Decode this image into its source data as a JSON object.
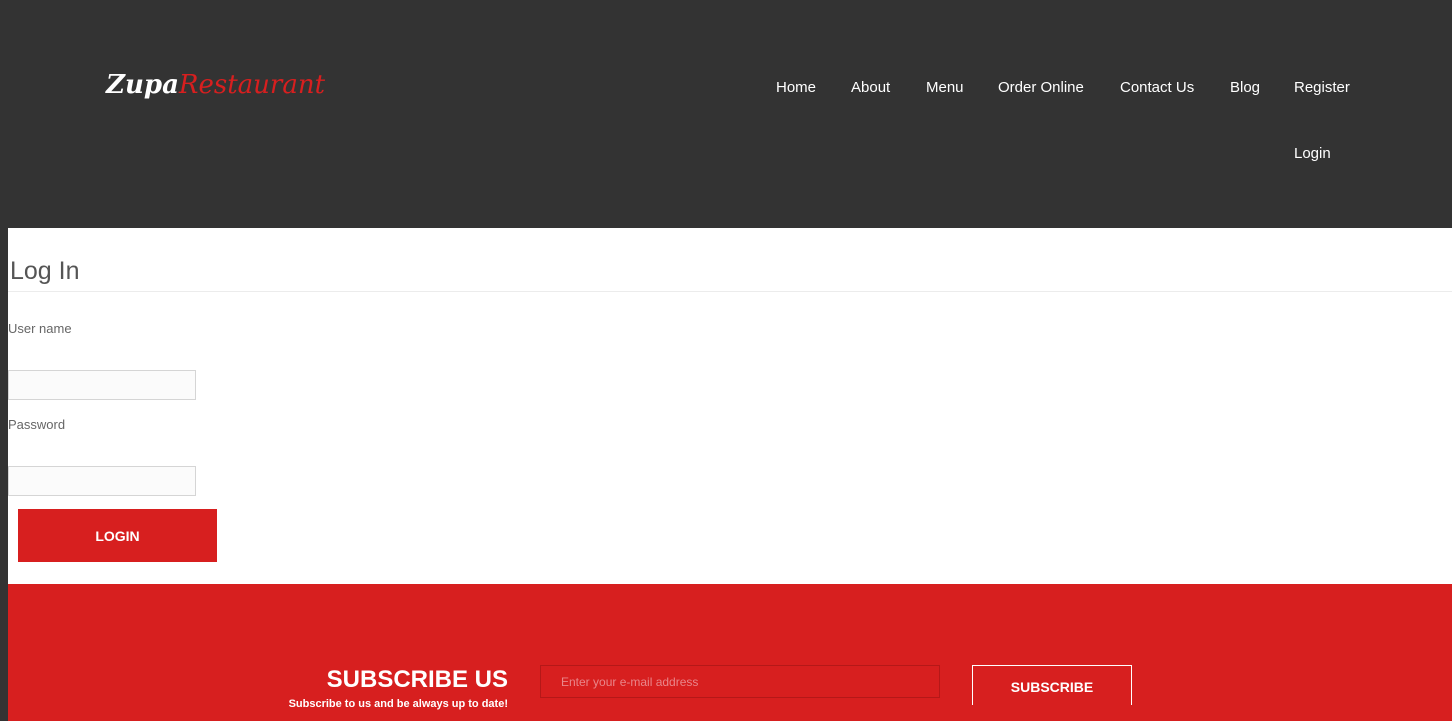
{
  "header": {
    "logo_part1": "Zupa",
    "logo_part2": "Restaurant",
    "nav": {
      "home": "Home",
      "about": "About",
      "menu": "Menu",
      "order_online": "Order Online",
      "contact_us": "Contact Us",
      "blog": "Blog",
      "register": "Register",
      "login": "Login"
    }
  },
  "login_form": {
    "title": "Log In",
    "username_label": "User name",
    "username_value": "",
    "password_label": "Password",
    "password_value": "",
    "submit_label": "LOGIN"
  },
  "subscribe": {
    "title": "SUBSCRIBE US",
    "subtitle": "Subscribe to us and be always up to date!",
    "email_placeholder": "Enter your e-mail address",
    "button_label": "SUBSCRIBE"
  },
  "colors": {
    "header_bg": "#333333",
    "accent_red": "#d71f1f",
    "content_bg": "#ffffff"
  }
}
